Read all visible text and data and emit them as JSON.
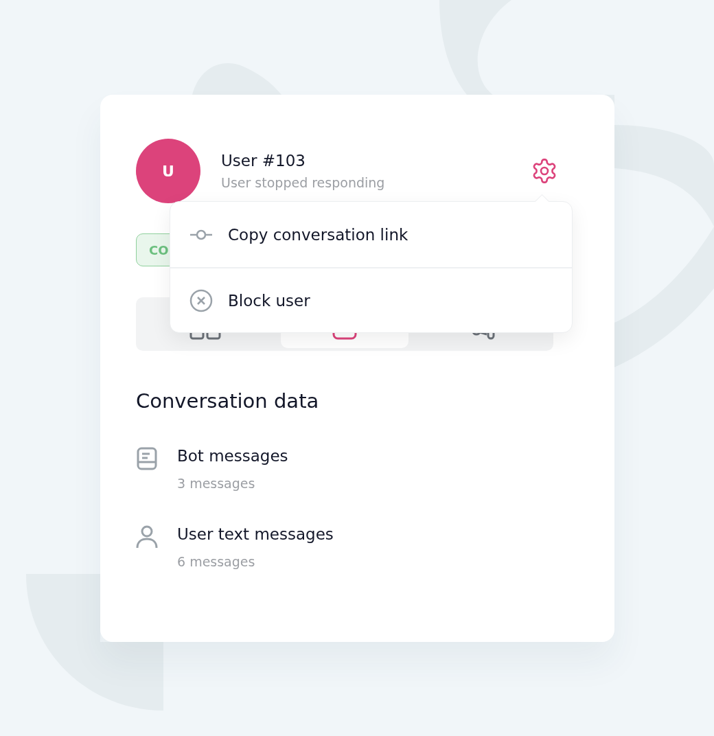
{
  "header": {
    "avatar": "U",
    "name": "User #103",
    "status": "User stopped responding"
  },
  "badge": {
    "label": "CO"
  },
  "tabs": [
    {
      "kind": "grid",
      "selected": false
    },
    {
      "kind": "chat",
      "selected": true
    },
    {
      "kind": "nodes",
      "selected": false
    }
  ],
  "menu": {
    "items": [
      {
        "kind": "link",
        "label": "Copy conversation link"
      },
      {
        "kind": "block",
        "label": "Block user"
      }
    ]
  },
  "section": {
    "title": "Conversation data",
    "items": [
      {
        "kind": "bot",
        "title": "Bot messages",
        "subtitle": "3 messages"
      },
      {
        "kind": "user",
        "title": "User text messages",
        "subtitle": "6 messages"
      }
    ]
  }
}
